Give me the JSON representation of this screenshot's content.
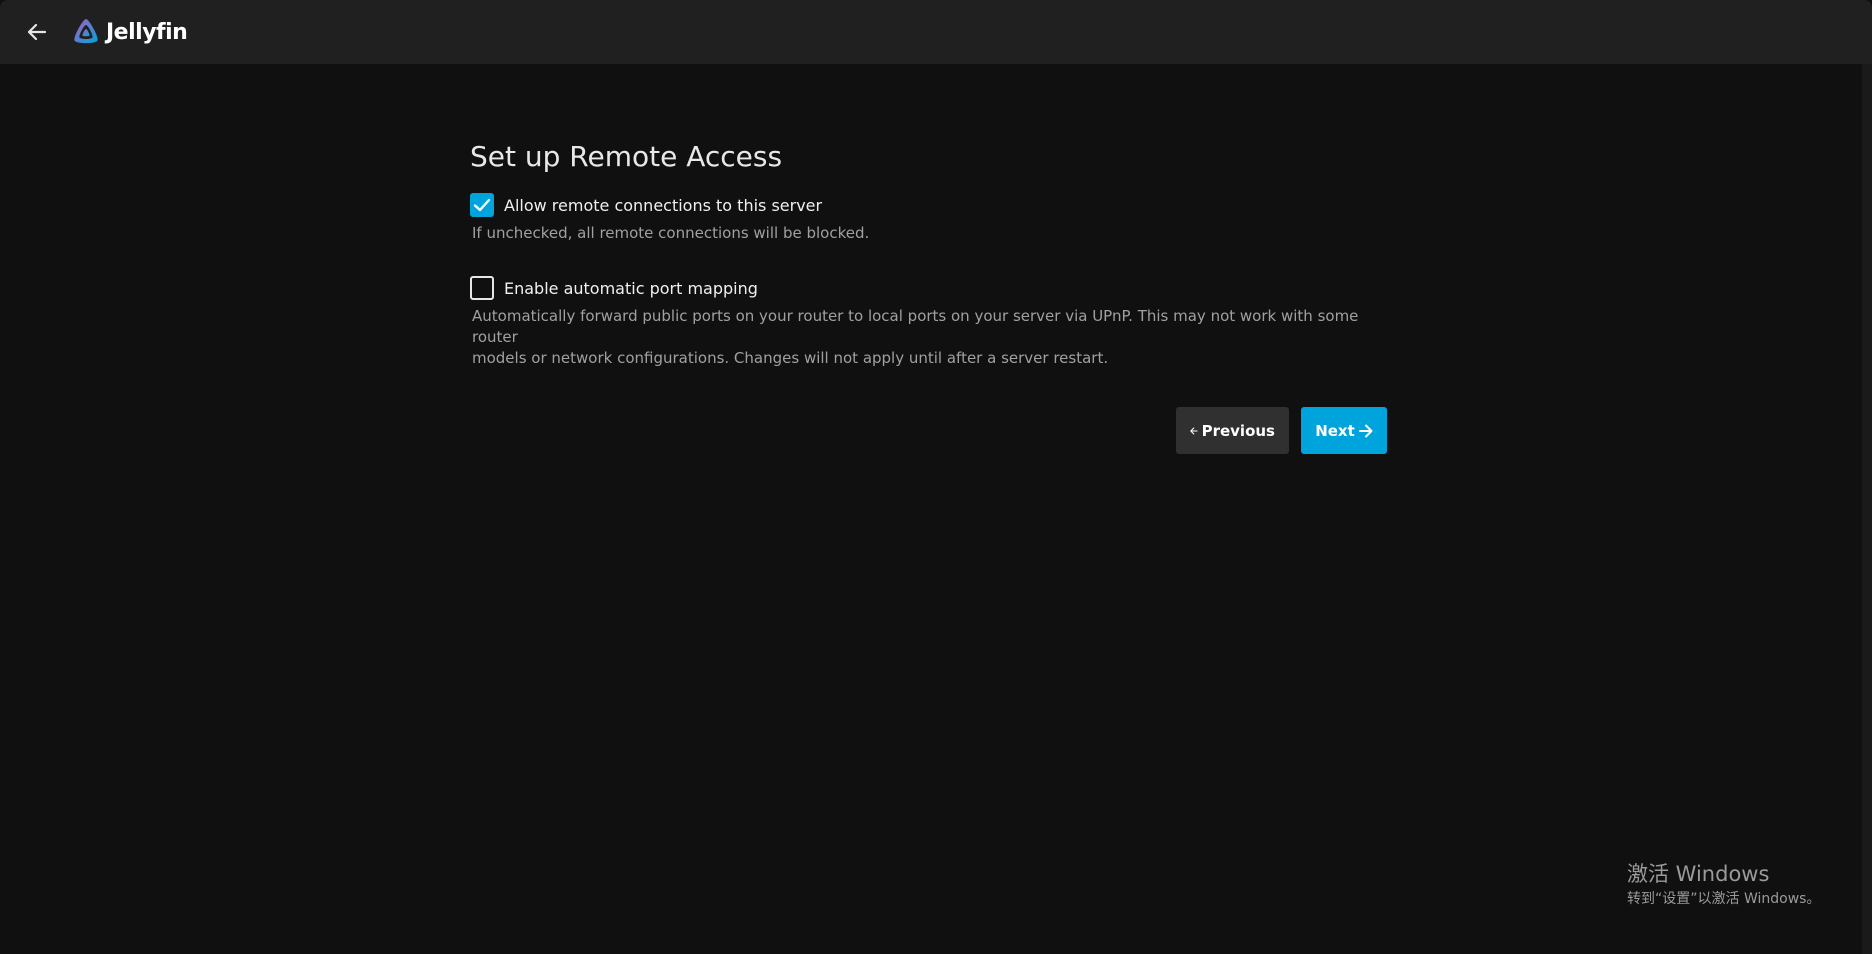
{
  "app": {
    "brand": "Jellyfin"
  },
  "wizard": {
    "title": "Set up Remote Access",
    "remote_connections": {
      "label": "Allow remote connections to this server",
      "checked": true,
      "helper": "If unchecked, all remote connections will be blocked."
    },
    "port_mapping": {
      "label": "Enable automatic port mapping",
      "checked": false,
      "helper_line1": "Automatically forward public ports on your router to local ports on your server via UPnP. This may not work with some router",
      "helper_line2": "models or network configurations. Changes will not apply until after a server restart."
    },
    "previous_label": "Previous",
    "next_label": "Next"
  },
  "watermark": {
    "title": "激活 Windows",
    "subtitle": "转到“设置”以激活 Windows。"
  },
  "colors": {
    "accent": "#00a4dc",
    "background": "#101010",
    "header": "#202020"
  },
  "icons": {
    "back": "arrow-left-icon",
    "logo": "jellyfin-logo-icon",
    "check": "check-icon",
    "prev": "arrow-left-icon",
    "next": "arrow-right-icon"
  }
}
